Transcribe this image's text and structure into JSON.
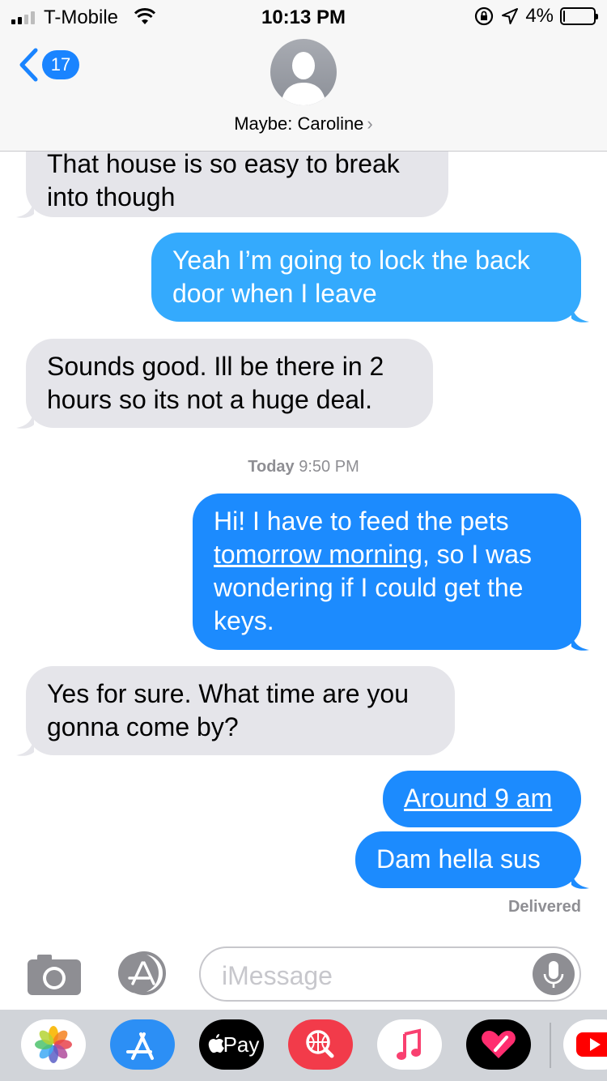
{
  "status_bar": {
    "carrier": "T-Mobile",
    "time": "10:13 PM",
    "battery_text": "4%",
    "battery_level": 0.04
  },
  "nav": {
    "back_count": "17",
    "contact_name": "Maybe: Caroline",
    "contact_chevron": "›"
  },
  "messages": [
    {
      "direction": "incoming",
      "lines": [
        "That house is so easy to break",
        "into though"
      ]
    },
    {
      "direction": "outgoing",
      "lines": [
        "Yeah I’m going to lock the back",
        "door when I leave"
      ]
    },
    {
      "direction": "incoming",
      "lines": [
        "Sounds good. Ill be there in 2",
        "hours so its not a huge deal."
      ]
    },
    {
      "direction": "outgoing",
      "line1": "Hi! I have to feed the pets",
      "link": "tomorrow morning",
      "line2_rest": ", so I was",
      "line3": "wondering if I could get the",
      "line4": "keys."
    },
    {
      "direction": "incoming",
      "lines": [
        "Yes for sure. What time are you",
        "gonna come by?"
      ]
    },
    {
      "direction": "outgoing",
      "link": "Around 9 am"
    },
    {
      "direction": "outgoing",
      "text": "Dam  hella  sus"
    }
  ],
  "timestamp": {
    "day": "Today",
    "time": "9:50 PM"
  },
  "delivered": "Delivered",
  "input": {
    "placeholder": "iMessage"
  },
  "app_drawer": {
    "apps": [
      "photos-icon",
      "app-store-icon",
      "apple-pay-icon",
      "web-images-icon",
      "music-icon",
      "digital-touch-icon",
      "youtube-icon"
    ],
    "apple_pay_label": "Pay"
  },
  "colors": {
    "outgoing": "#1c8bfe",
    "outgoing_older": "#34aafd",
    "incoming": "#e5e5ea",
    "badge": "#1a84ff"
  }
}
